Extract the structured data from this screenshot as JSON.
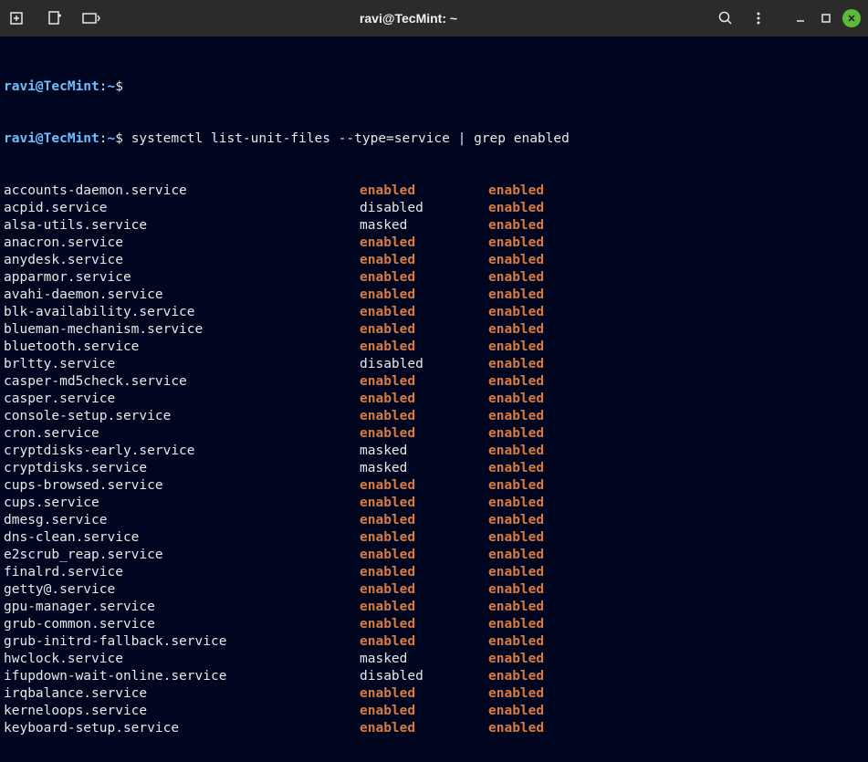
{
  "window": {
    "title": "ravi@TecMint: ~"
  },
  "prompt": {
    "user_host": "ravi@TecMint",
    "sep": ":",
    "path": "~",
    "dollar": "$"
  },
  "command": "systemctl list-unit-files --type=service | grep enabled",
  "services": [
    {
      "name": "accounts-daemon.service",
      "state1": "enabled",
      "state2": "enabled"
    },
    {
      "name": "acpid.service",
      "state1": "disabled",
      "state2": "enabled"
    },
    {
      "name": "alsa-utils.service",
      "state1": "masked",
      "state2": "enabled"
    },
    {
      "name": "anacron.service",
      "state1": "enabled",
      "state2": "enabled"
    },
    {
      "name": "anydesk.service",
      "state1": "enabled",
      "state2": "enabled"
    },
    {
      "name": "apparmor.service",
      "state1": "enabled",
      "state2": "enabled"
    },
    {
      "name": "avahi-daemon.service",
      "state1": "enabled",
      "state2": "enabled"
    },
    {
      "name": "blk-availability.service",
      "state1": "enabled",
      "state2": "enabled"
    },
    {
      "name": "blueman-mechanism.service",
      "state1": "enabled",
      "state2": "enabled"
    },
    {
      "name": "bluetooth.service",
      "state1": "enabled",
      "state2": "enabled"
    },
    {
      "name": "brltty.service",
      "state1": "disabled",
      "state2": "enabled"
    },
    {
      "name": "casper-md5check.service",
      "state1": "enabled",
      "state2": "enabled"
    },
    {
      "name": "casper.service",
      "state1": "enabled",
      "state2": "enabled"
    },
    {
      "name": "console-setup.service",
      "state1": "enabled",
      "state2": "enabled"
    },
    {
      "name": "cron.service",
      "state1": "enabled",
      "state2": "enabled"
    },
    {
      "name": "cryptdisks-early.service",
      "state1": "masked",
      "state2": "enabled"
    },
    {
      "name": "cryptdisks.service",
      "state1": "masked",
      "state2": "enabled"
    },
    {
      "name": "cups-browsed.service",
      "state1": "enabled",
      "state2": "enabled"
    },
    {
      "name": "cups.service",
      "state1": "enabled",
      "state2": "enabled"
    },
    {
      "name": "dmesg.service",
      "state1": "enabled",
      "state2": "enabled"
    },
    {
      "name": "dns-clean.service",
      "state1": "enabled",
      "state2": "enabled"
    },
    {
      "name": "e2scrub_reap.service",
      "state1": "enabled",
      "state2": "enabled"
    },
    {
      "name": "finalrd.service",
      "state1": "enabled",
      "state2": "enabled"
    },
    {
      "name": "getty@.service",
      "state1": "enabled",
      "state2": "enabled"
    },
    {
      "name": "gpu-manager.service",
      "state1": "enabled",
      "state2": "enabled"
    },
    {
      "name": "grub-common.service",
      "state1": "enabled",
      "state2": "enabled"
    },
    {
      "name": "grub-initrd-fallback.service",
      "state1": "enabled",
      "state2": "enabled"
    },
    {
      "name": "hwclock.service",
      "state1": "masked",
      "state2": "enabled"
    },
    {
      "name": "ifupdown-wait-online.service",
      "state1": "disabled",
      "state2": "enabled"
    },
    {
      "name": "irqbalance.service",
      "state1": "enabled",
      "state2": "enabled"
    },
    {
      "name": "kerneloops.service",
      "state1": "enabled",
      "state2": "enabled"
    },
    {
      "name": "keyboard-setup.service",
      "state1": "enabled",
      "state2": "enabled"
    }
  ]
}
